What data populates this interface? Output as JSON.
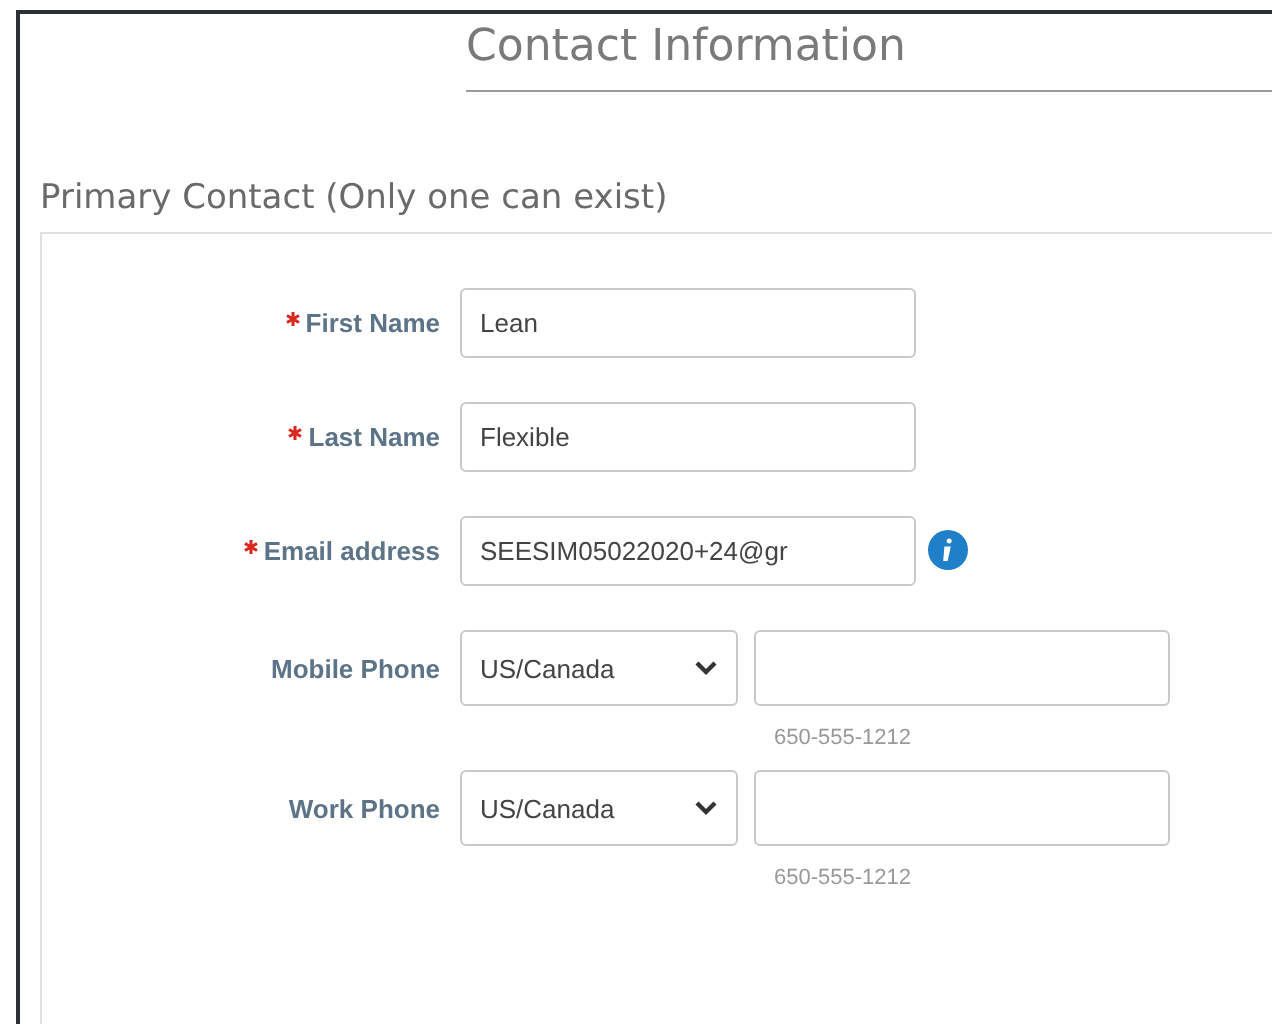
{
  "title": "Contact Information",
  "section": {
    "heading": "Primary Contact (Only one can exist)",
    "fields": [
      {
        "kind": "text",
        "label": "First Name",
        "required": true,
        "value": "Lean",
        "info": false
      },
      {
        "kind": "text",
        "label": "Last Name",
        "required": true,
        "value": "Flexible",
        "info": false
      },
      {
        "kind": "text",
        "label": "Email address",
        "required": true,
        "value": "SEESIM05022020+24@gr",
        "info": true
      },
      {
        "kind": "phone",
        "label": "Mobile Phone",
        "required": false,
        "country": "US/Canada",
        "hint": "650-555-1212"
      },
      {
        "kind": "phone",
        "label": "Work Phone",
        "required": false,
        "country": "US/Canada",
        "hint": "650-555-1212"
      }
    ]
  }
}
